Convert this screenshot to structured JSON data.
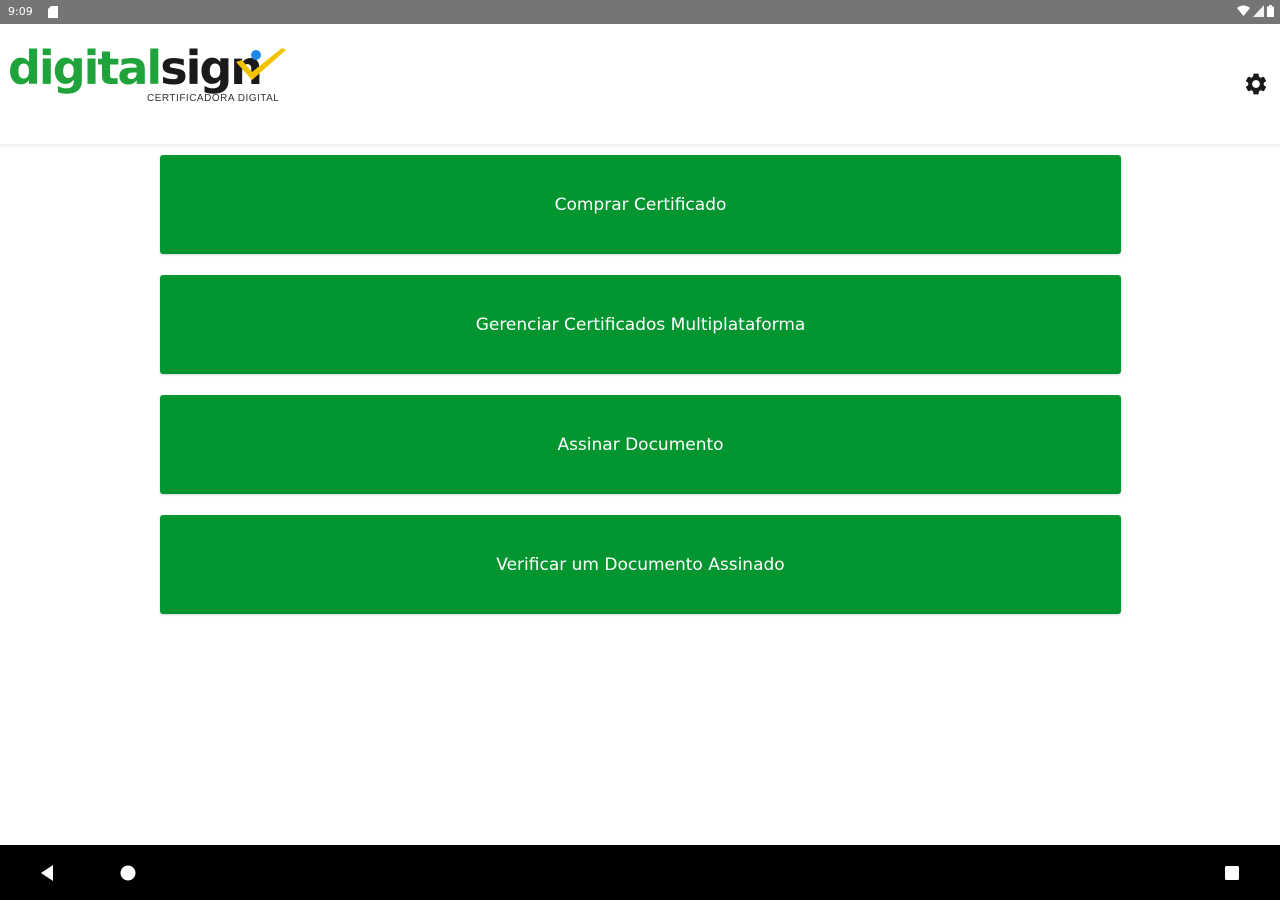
{
  "status_bar": {
    "time": "9:09",
    "icons": [
      "sd-card-icon",
      "wifi-icon",
      "signal-icon",
      "battery-icon"
    ]
  },
  "app_bar": {
    "logo": {
      "part1": "digital",
      "part2": "sign",
      "subtitle": "CERTIFICADORA DIGITAL"
    },
    "settings_icon": "gear-icon"
  },
  "actions": [
    {
      "label": "Comprar Certificado"
    },
    {
      "label": "Gerenciar Certificados Multiplataforma"
    },
    {
      "label": "Assinar Documento"
    },
    {
      "label": "Verificar um Documento Assinado"
    }
  ],
  "nav_bar": {
    "icons": [
      "back-icon",
      "home-icon",
      "recents-icon"
    ]
  },
  "colors": {
    "button_green": "#029530",
    "logo_green": "#1fa33a",
    "logo_check_yellow": "#f2c300",
    "logo_dot_blue": "#1e88e5",
    "status_bar": "#757575",
    "nav_bar": "#000000"
  }
}
